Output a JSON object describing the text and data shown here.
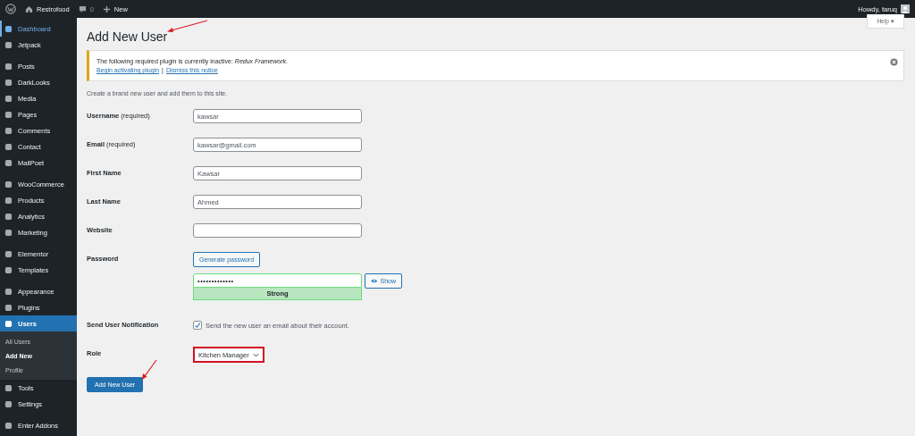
{
  "top_bar": {
    "site": "Restrofood",
    "comments": "0",
    "new": "New",
    "greeting": "Howdy, faruq"
  },
  "sidebar": {
    "groups": [
      {
        "items": [
          {
            "label": "Dashboard",
            "selected": false,
            "hovered": true
          },
          {
            "label": "Jetpack",
            "selected": false,
            "hovered": false
          }
        ]
      },
      {
        "items": [
          {
            "label": "Posts",
            "selected": false,
            "hovered": false
          },
          {
            "label": "DarkLooks",
            "selected": false,
            "hovered": false
          },
          {
            "label": "Media",
            "selected": false,
            "hovered": false
          },
          {
            "label": "Pages",
            "selected": false,
            "hovered": false
          },
          {
            "label": "Comments",
            "selected": false,
            "hovered": false
          },
          {
            "label": "Contact",
            "selected": false,
            "hovered": false
          },
          {
            "label": "MailPoet",
            "selected": false,
            "hovered": false
          }
        ]
      },
      {
        "items": [
          {
            "label": "WooCommerce",
            "selected": false,
            "hovered": false
          },
          {
            "label": "Products",
            "selected": false,
            "hovered": false
          },
          {
            "label": "Analytics",
            "selected": false,
            "hovered": false
          },
          {
            "label": "Marketing",
            "selected": false,
            "hovered": false
          }
        ]
      },
      {
        "items": [
          {
            "label": "Elementor",
            "selected": false,
            "hovered": false
          },
          {
            "label": "Templates",
            "selected": false,
            "hovered": false
          }
        ]
      },
      {
        "items": [
          {
            "label": "Appearance",
            "selected": false,
            "hovered": false
          },
          {
            "label": "Plugins",
            "selected": false,
            "hovered": false
          },
          {
            "label": "Users",
            "selected": true,
            "hovered": false,
            "children": [
              {
                "label": "All Users",
                "selected": false
              },
              {
                "label": "Add New",
                "selected": true
              },
              {
                "label": "Profile",
                "selected": false
              }
            ]
          },
          {
            "label": "Tools",
            "selected": false,
            "hovered": false
          },
          {
            "label": "Settings",
            "selected": false,
            "hovered": false
          }
        ]
      },
      {
        "items": [
          {
            "label": "Enter Addons",
            "selected": false,
            "hovered": false
          }
        ]
      }
    ]
  },
  "help": "Help ▾",
  "title": "Add New User",
  "notice": {
    "text": "The following required plugin is currently inactive: *Redux Framework*.",
    "links": [
      "Begin activating plugin",
      "Dismiss this notice"
    ],
    "separator": "|"
  },
  "intro": "Create a brand new user and add them to this site.",
  "form": {
    "fields": [
      {
        "kind": "text",
        "label": "Username",
        "note": "(required)",
        "value": "kawsar"
      },
      {
        "kind": "text",
        "label": "Email",
        "note": "(required)",
        "value": "kawsar@gmail.com"
      },
      {
        "kind": "text",
        "label": "First Name",
        "value": "Kawsar"
      },
      {
        "kind": "text",
        "label": "Last Name",
        "value": "Ahmed"
      },
      {
        "kind": "text",
        "label": "Website"
      },
      {
        "kind": "password",
        "label": "Password",
        "generate": "Generate password",
        "value": "•••••••••••••",
        "strength": "Strong",
        "show": "Show"
      },
      {
        "kind": "checkbox",
        "label": "Send User Notification",
        "checked": true,
        "text": "Send the new user an email about their account."
      },
      {
        "kind": "select",
        "label": "Role",
        "value": "Kitchen Manager",
        "highlighted": true
      }
    ]
  },
  "submit": "Add New User"
}
